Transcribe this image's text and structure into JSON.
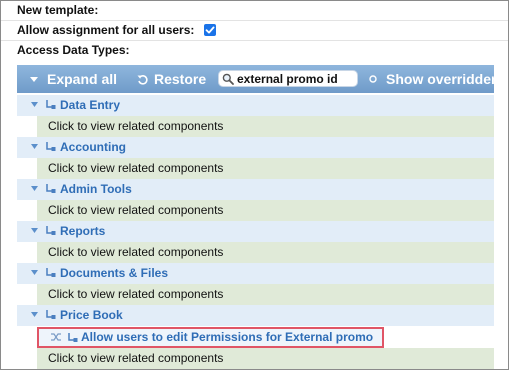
{
  "form": {
    "new_template_label": "New template:",
    "allow_assignment_label": "Allow assignment for all users:",
    "allow_assignment_checked": true,
    "access_data_types_label": "Access Data Types:"
  },
  "toolbar": {
    "expand_all_label": "Expand all",
    "restore_label": "Restore",
    "search_value": "external promo id",
    "show_overridden_label": "Show overridden"
  },
  "tree": {
    "child_text": "Click to view related components",
    "sections": [
      {
        "label": "Data Entry"
      },
      {
        "label": "Accounting"
      },
      {
        "label": "Admin Tools"
      },
      {
        "label": "Reports"
      },
      {
        "label": "Documents & Files"
      },
      {
        "label": "Price Book"
      }
    ],
    "highlighted_item": {
      "label": "Allow users to edit Permissions for External promo ID"
    }
  },
  "colors": {
    "toolbar": "#7aa5d2",
    "section_header_bg": "#e2edf8",
    "section_header_text": "#2f6db6",
    "row_bg": "#e0ead8",
    "highlight_border": "#e05566",
    "checkbox": "#1a73e8"
  },
  "icons": {
    "expand": "triangle-down-icon",
    "restore": "restore-icon",
    "search": "magnifier-icon",
    "show_overridden": "circle-icon",
    "tree_node": "node-icon",
    "shuffle": "shuffle-icon"
  }
}
